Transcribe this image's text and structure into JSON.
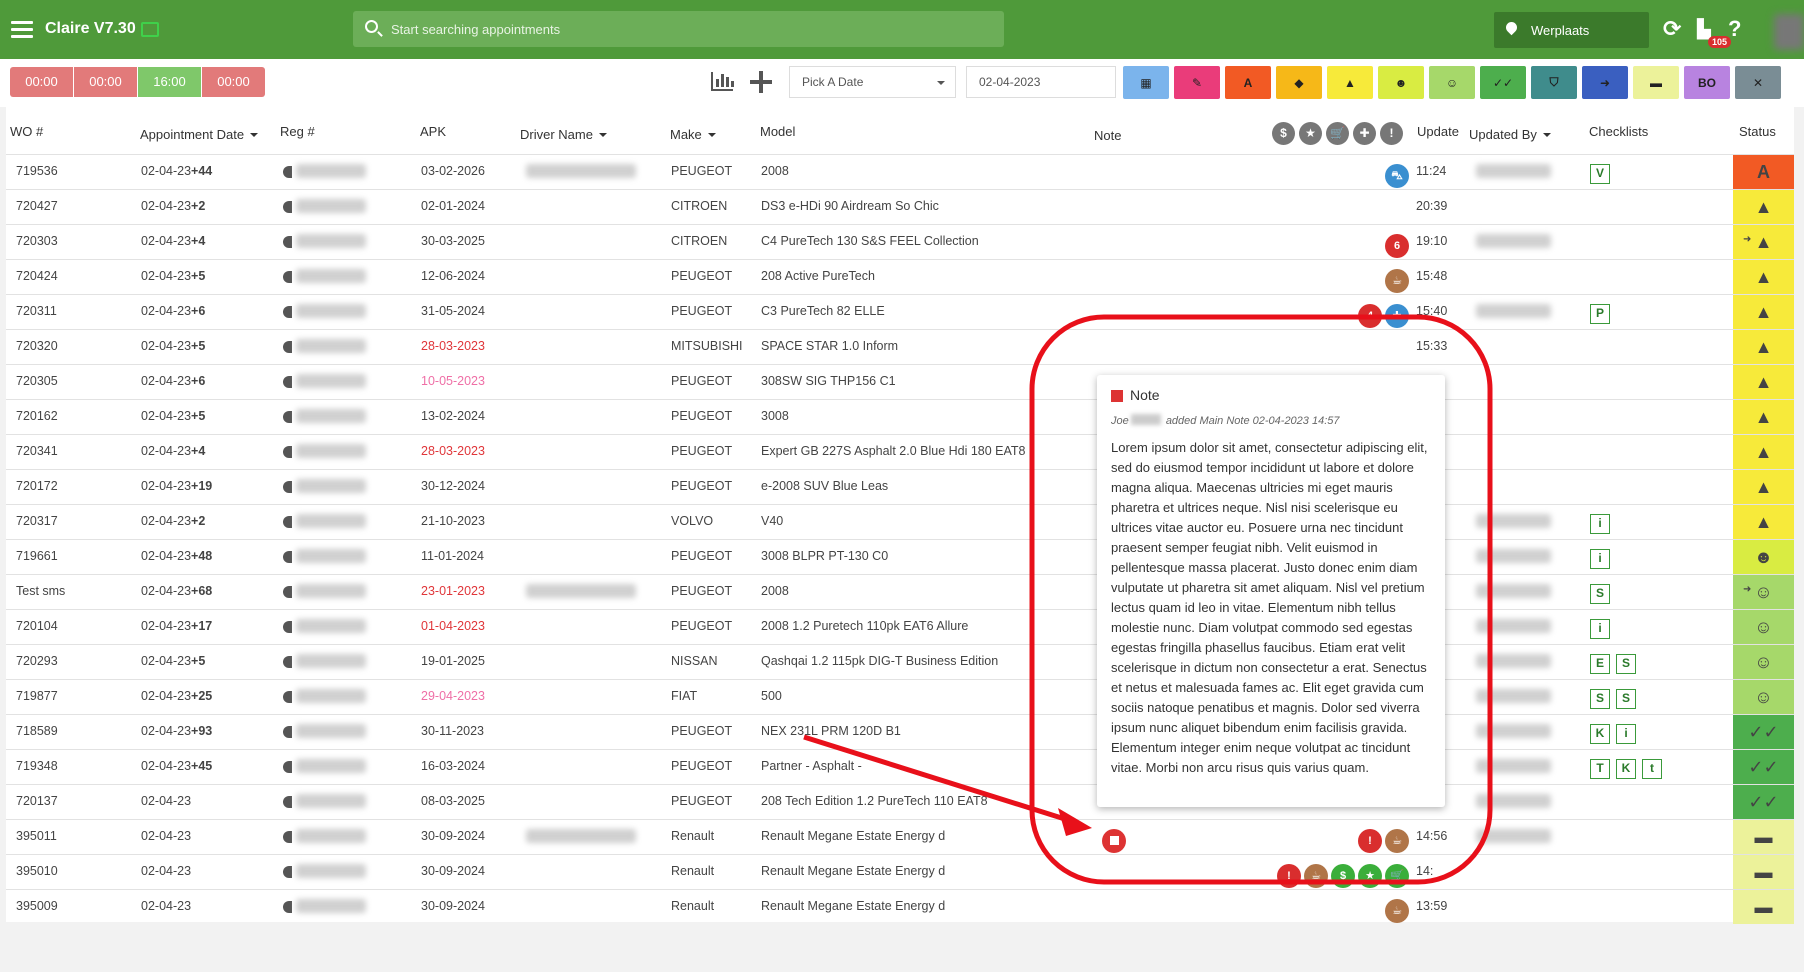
{
  "app": {
    "title": "Claire V7.30"
  },
  "search": {
    "placeholder": "Start searching appointments"
  },
  "workplace": {
    "label": "Werplaats"
  },
  "notifications": {
    "count": "105"
  },
  "help": {
    "label": "?"
  },
  "refresh": {
    "label": "⟳"
  },
  "timers": [
    {
      "label": "00:00",
      "color": "#e27a7a"
    },
    {
      "label": "00:00",
      "color": "#e27a7a"
    },
    {
      "label": "16:00",
      "color": "#7fc86a"
    },
    {
      "label": "00:00",
      "color": "#e27a7a"
    }
  ],
  "toolbar": {
    "pick_date": "Pick A Date",
    "date_value": "02-04-2023",
    "filters": [
      {
        "icon": "calendar-icon",
        "glyph": "▦",
        "color": "#7bb4ec"
      },
      {
        "icon": "wrench-icon",
        "glyph": "✎",
        "color": "#ea3c7a"
      },
      {
        "icon": "letter-a-icon",
        "glyph": "A",
        "color": "#f25a24"
      },
      {
        "icon": "tag-icon",
        "glyph": "◆",
        "color": "#f6b818"
      },
      {
        "icon": "warning-icon",
        "glyph": "▲",
        "color": "#f7ea3a"
      },
      {
        "icon": "user-check-icon",
        "glyph": "☻",
        "color": "#d9ec42"
      },
      {
        "icon": "smiley-icon",
        "glyph": "☺",
        "color": "#a6d86a"
      },
      {
        "icon": "double-check-icon",
        "glyph": "✓✓",
        "color": "#4dae4d"
      },
      {
        "icon": "shield-icon",
        "glyph": "⛉",
        "color": "#3f8c8c"
      },
      {
        "icon": "exit-icon",
        "glyph": "➜",
        "color": "#3a5fc0"
      },
      {
        "icon": "car-icon",
        "glyph": "▬",
        "color": "#ecf29a"
      },
      {
        "icon": "bo-text",
        "glyph": "BO",
        "color": "#b883e0"
      },
      {
        "icon": "cancel-icon",
        "glyph": "✕",
        "color": "#7a8d95"
      }
    ]
  },
  "columns": {
    "wo": "WO #",
    "appt_date": "Appointment Date",
    "reg": "Reg #",
    "apk": "APK",
    "driver": "Driver Name",
    "make": "Make",
    "model": "Model",
    "note": "Note",
    "update": "Update",
    "updated_by": "Updated By",
    "checklists": "Checklists",
    "status": "Status"
  },
  "header_icons": [
    "$",
    "★",
    "🛒",
    "✚",
    "!"
  ],
  "rows": [
    {
      "wo": "719536",
      "date": "02-04-23",
      "plus": "+44",
      "apk": "03-02-2026",
      "apk_cls": "",
      "make": "PEUGEOT",
      "model": "2008",
      "update": "11:24",
      "checks": [
        "V"
      ],
      "status": "letter-a",
      "status_bg": "#f25a24",
      "icons": [
        {
          "g": "⛍",
          "c": "#3a8fd0"
        }
      ],
      "driver": true,
      "upd": true,
      "arrow": false
    },
    {
      "wo": "720427",
      "date": "02-04-23",
      "plus": "+2",
      "apk": "02-01-2024",
      "apk_cls": "",
      "make": "CITROEN",
      "model": "DS3 e-HDi 90 Airdream So Chic",
      "update": "20:39",
      "checks": [],
      "status": "warning",
      "status_bg": "#f7ea3a",
      "icons": [],
      "driver": false,
      "upd": false,
      "arrow": false
    },
    {
      "wo": "720303",
      "date": "02-04-23",
      "plus": "+4",
      "apk": "30-03-2025",
      "apk_cls": "",
      "make": "CITROEN",
      "model": "C4 PureTech 130 S&S FEEL Collection",
      "update": "19:10",
      "checks": [],
      "status": "warning",
      "status_bg": "#f7ea3a",
      "icons": [
        {
          "g": "6",
          "c": "#d92e2e"
        }
      ],
      "driver": false,
      "upd": true,
      "arrow": true
    },
    {
      "wo": "720424",
      "date": "02-04-23",
      "plus": "+5",
      "apk": "12-06-2024",
      "apk_cls": "",
      "make": "PEUGEOT",
      "model": "208 Active PureTech",
      "update": "15:48",
      "checks": [],
      "status": "warning",
      "status_bg": "#f7ea3a",
      "icons": [
        {
          "g": "☕",
          "c": "#b07548"
        }
      ],
      "driver": false,
      "upd": false,
      "arrow": false
    },
    {
      "wo": "720311",
      "date": "02-04-23",
      "plus": "+6",
      "apk": "31-05-2024",
      "apk_cls": "",
      "make": "PEUGEOT",
      "model": "C3 PureTech 82 ELLE",
      "update": "15:40",
      "checks": [
        "P"
      ],
      "status": "warning",
      "status_bg": "#f7ea3a",
      "icons": [
        {
          "g": "4",
          "c": "#d92e2e"
        },
        {
          "g": "✚",
          "c": "#3a8fd0"
        }
      ],
      "driver": false,
      "upd": true,
      "arrow": false
    },
    {
      "wo": "720320",
      "date": "02-04-23",
      "plus": "+5",
      "apk": "28-03-2023",
      "apk_cls": "red",
      "make": "MITSUBISHI",
      "model": "SPACE STAR 1.0 Inform",
      "update": "15:33",
      "checks": [],
      "status": "warning",
      "status_bg": "#f7ea3a",
      "icons": [],
      "driver": false,
      "upd": false,
      "arrow": false
    },
    {
      "wo": "720305",
      "date": "02-04-23",
      "plus": "+6",
      "apk": "10-05-2023",
      "apk_cls": "pink",
      "make": "PEUGEOT",
      "model": "308SW SIG THP156 C1",
      "update": "",
      "checks": [],
      "status": "warning",
      "status_bg": "#f7ea3a",
      "icons": [],
      "driver": false,
      "upd": false,
      "arrow": false
    },
    {
      "wo": "720162",
      "date": "02-04-23",
      "plus": "+5",
      "apk": "13-02-2024",
      "apk_cls": "",
      "make": "PEUGEOT",
      "model": "3008",
      "update": "",
      "checks": [],
      "status": "warning",
      "status_bg": "#f7ea3a",
      "icons": [],
      "driver": false,
      "upd": false,
      "arrow": false
    },
    {
      "wo": "720341",
      "date": "02-04-23",
      "plus": "+4",
      "apk": "28-03-2023",
      "apk_cls": "red",
      "make": "PEUGEOT",
      "model": "Expert GB 227S Asphalt 2.0 Blue Hdi 180 EAT8",
      "update": "",
      "checks": [],
      "status": "warning",
      "status_bg": "#f7ea3a",
      "icons": [],
      "driver": false,
      "upd": false,
      "arrow": false
    },
    {
      "wo": "720172",
      "date": "02-04-23",
      "plus": "+19",
      "apk": "30-12-2024",
      "apk_cls": "",
      "make": "PEUGEOT",
      "model": "e-2008 SUV Blue Leas",
      "update": "",
      "checks": [],
      "status": "warning",
      "status_bg": "#f7ea3a",
      "icons": [],
      "driver": false,
      "upd": false,
      "arrow": false
    },
    {
      "wo": "720317",
      "date": "02-04-23",
      "plus": "+2",
      "apk": "21-10-2023",
      "apk_cls": "",
      "make": "VOLVO",
      "model": "V40",
      "update": "",
      "checks": [
        "i"
      ],
      "status": "warning",
      "status_bg": "#f7ea3a",
      "icons": [],
      "driver": false,
      "upd": true,
      "arrow": false
    },
    {
      "wo": "719661",
      "date": "02-04-23",
      "plus": "+48",
      "apk": "11-01-2024",
      "apk_cls": "",
      "make": "PEUGEOT",
      "model": "3008 BLPR PT-130 C0",
      "update": "",
      "checks": [
        "i"
      ],
      "status": "user-check",
      "status_bg": "#d9ec42",
      "icons": [],
      "driver": false,
      "upd": true,
      "arrow": false
    },
    {
      "wo": "Test sms",
      "date": "02-04-23",
      "plus": "+68",
      "apk": "23-01-2023",
      "apk_cls": "red",
      "make": "PEUGEOT",
      "model": "2008",
      "update": "",
      "checks": [
        "S"
      ],
      "status": "smiley",
      "status_bg": "#a6d86a",
      "icons": [],
      "driver": true,
      "upd": true,
      "arrow": true
    },
    {
      "wo": "720104",
      "date": "02-04-23",
      "plus": "+17",
      "apk": "01-04-2023",
      "apk_cls": "red",
      "make": "PEUGEOT",
      "model": "2008 1.2 Puretech 110pk EAT6 Allure",
      "update": "",
      "checks": [
        "i"
      ],
      "status": "smiley",
      "status_bg": "#a6d86a",
      "icons": [],
      "driver": false,
      "upd": true,
      "arrow": false
    },
    {
      "wo": "720293",
      "date": "02-04-23",
      "plus": "+5",
      "apk": "19-01-2025",
      "apk_cls": "",
      "make": "NISSAN",
      "model": "Qashqai 1.2 115pk DIG-T Business Edition",
      "update": "",
      "checks": [
        "E",
        "S"
      ],
      "status": "smiley",
      "status_bg": "#a6d86a",
      "icons": [],
      "driver": false,
      "upd": true,
      "arrow": false
    },
    {
      "wo": "719877",
      "date": "02-04-23",
      "plus": "+25",
      "apk": "29-04-2023",
      "apk_cls": "pink",
      "make": "FIAT",
      "model": "500",
      "update": "",
      "checks": [
        "S",
        "S"
      ],
      "status": "smiley",
      "status_bg": "#a6d86a",
      "icons": [],
      "driver": false,
      "upd": true,
      "arrow": false
    },
    {
      "wo": "718589",
      "date": "02-04-23",
      "plus": "+93",
      "apk": "30-11-2023",
      "apk_cls": "",
      "make": "PEUGEOT",
      "model": "NEX 231L PRM 120D B1",
      "update": "",
      "checks": [
        "K",
        "i"
      ],
      "status": "double-check",
      "status_bg": "#4dae4d",
      "icons": [],
      "driver": false,
      "upd": true,
      "arrow": false
    },
    {
      "wo": "719348",
      "date": "02-04-23",
      "plus": "+45",
      "apk": "16-03-2024",
      "apk_cls": "",
      "make": "PEUGEOT",
      "model": "Partner - Asphalt -",
      "update": "",
      "checks": [
        "T",
        "K",
        "t"
      ],
      "status": "double-check",
      "status_bg": "#4dae4d",
      "icons": [],
      "driver": false,
      "upd": true,
      "arrow": false
    },
    {
      "wo": "720137",
      "date": "02-04-23",
      "plus": "",
      "apk": "08-03-2025",
      "apk_cls": "",
      "make": "PEUGEOT",
      "model": "208 Tech Edition 1.2 PureTech 110 EAT8",
      "update": "",
      "checks": [],
      "status": "double-check",
      "status_bg": "#4dae4d",
      "icons": [],
      "driver": false,
      "upd": true,
      "arrow": false
    },
    {
      "wo": "395011",
      "date": "02-04-23",
      "plus": "",
      "apk": "30-09-2024",
      "apk_cls": "",
      "make": "Renault",
      "model": "Renault Megane Estate Energy d",
      "update": "14:56",
      "checks": [],
      "status": "car",
      "status_bg": "#ecf29a",
      "icons": [
        {
          "g": "!",
          "c": "#d92e2e"
        },
        {
          "g": "☕",
          "c": "#b07548"
        }
      ],
      "note_icon": true,
      "driver": true,
      "upd": true,
      "arrow": false
    },
    {
      "wo": "395010",
      "date": "02-04-23",
      "plus": "",
      "apk": "30-09-2024",
      "apk_cls": "",
      "make": "Renault",
      "model": "Renault Megane Estate Energy d",
      "update": "14:",
      "checks": [],
      "status": "car",
      "status_bg": "#ecf29a",
      "icons": [
        {
          "g": "!",
          "c": "#d92e2e"
        },
        {
          "g": "☕",
          "c": "#b07548"
        },
        {
          "g": "$",
          "c": "#3aae3a"
        },
        {
          "g": "★",
          "c": "#3aae3a"
        },
        {
          "g": "🛒",
          "c": "#3aae3a"
        }
      ],
      "driver": false,
      "upd": false,
      "arrow": false
    },
    {
      "wo": "395009",
      "date": "02-04-23",
      "plus": "",
      "apk": "30-09-2024",
      "apk_cls": "",
      "make": "Renault",
      "model": "Renault Megane Estate Energy d",
      "update": "13:59",
      "checks": [],
      "status": "car",
      "status_bg": "#ecf29a",
      "icons": [
        {
          "g": "☕",
          "c": "#b07548"
        }
      ],
      "driver": false,
      "upd": false,
      "arrow": false
    }
  ],
  "status_glyphs": {
    "letter-a": "A",
    "warning": "▲",
    "user-check": "☻",
    "smiley": "☺",
    "double-check": "✓✓",
    "car": "▬"
  },
  "popup": {
    "title": "Note",
    "author": "Joe",
    "meta": "added Main Note 02-04-2023 14:57",
    "body": "Lorem ipsum dolor sit amet, consectetur adipiscing elit, sed do eiusmod tempor incididunt ut labore et dolore magna aliqua. Maecenas ultricies mi eget mauris pharetra et ultrices neque. Nisl nisi scelerisque eu ultrices vitae auctor eu. Posuere urna nec tincidunt praesent semper feugiat nibh. Velit euismod in pellentesque massa placerat. Justo donec enim diam vulputate ut pharetra sit amet aliquam. Nisl vel pretium lectus quam id leo in vitae. Elementum nibh tellus molestie nunc. Diam volutpat commodo sed egestas egestas fringilla phasellus faucibus. Etiam erat velit scelerisque in dictum non consectetur a erat. Senectus et netus et malesuada fames ac. Elit eget gravida cum sociis natoque penatibus et magnis. Dolor sed viverra ipsum nunc aliquet bibendum enim facilisis gravida. Elementum integer enim neque volutpat ac tincidunt vitae. Morbi non arcu risus quis varius quam."
  }
}
